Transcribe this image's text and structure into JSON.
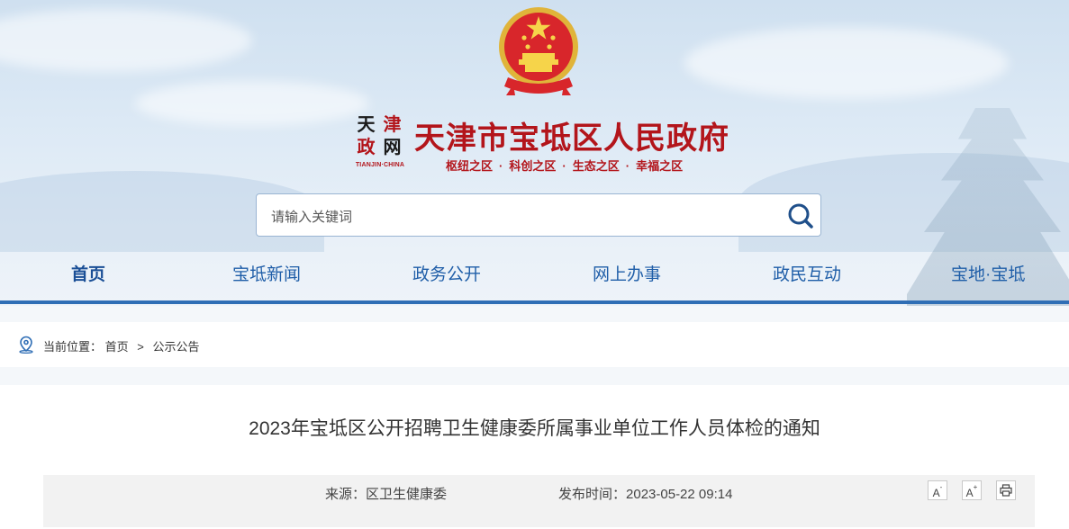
{
  "header": {
    "site_title": "天津市宝坻区人民政府",
    "slogan": [
      "枢纽之区",
      "科创之区",
      "生态之区",
      "幸福之区"
    ],
    "slogan_separator": "·",
    "seal_chars": [
      "天",
      "津",
      "政",
      "网"
    ],
    "seal_en": "TIANJIN·CHINA",
    "emblem_icon": "national-emblem-icon",
    "brand_color": "#b3151b"
  },
  "search": {
    "placeholder": "请输入关键词",
    "button_icon": "search-icon"
  },
  "nav": {
    "items": [
      {
        "label": "首页",
        "active": true
      },
      {
        "label": "宝坻新闻",
        "active": false
      },
      {
        "label": "政务公开",
        "active": false
      },
      {
        "label": "网上办事",
        "active": false
      },
      {
        "label": "政民互动",
        "active": false
      },
      {
        "label": "宝地·宝坻",
        "active": false
      }
    ],
    "accent_color": "#2f6eb5"
  },
  "breadcrumb": {
    "icon": "location-pin-icon",
    "prefix": "当前位置：",
    "items": [
      "首页",
      "公示公告"
    ],
    "separator": ">"
  },
  "article": {
    "title": "2023年宝坻区公开招聘卫生健康委所属事业单位工作人员体检的通知",
    "source_label": "来源：",
    "source": "区卫生健康委",
    "time_label": "发布时间：",
    "time": "2023-05-22 09:14",
    "tools": {
      "font_decrease": "A",
      "font_decrease_mark": "-",
      "font_increase": "A",
      "font_increase_mark": "+",
      "print_icon": "print-icon"
    }
  }
}
